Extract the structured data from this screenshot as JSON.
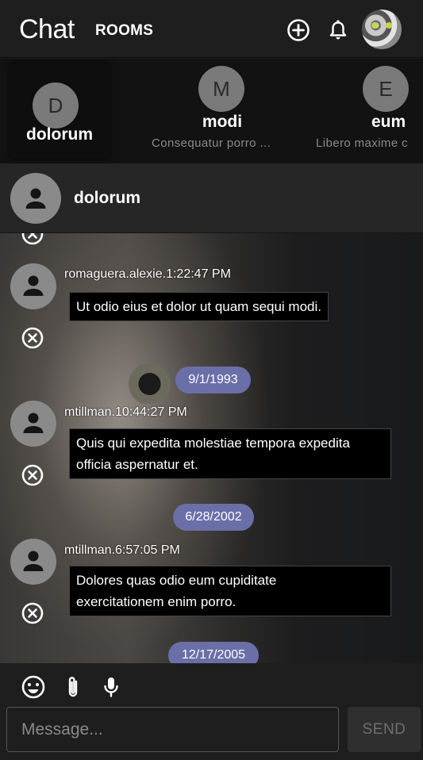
{
  "header": {
    "title": "Chat",
    "rooms_label": "ROOMS",
    "icons": {
      "add": "add-circle-icon",
      "notifications": "bell-icon",
      "avatar": "user-avatar-photo"
    }
  },
  "rooms": [
    {
      "initial": "D",
      "name": "dolorum",
      "preview": "",
      "active": true
    },
    {
      "initial": "M",
      "name": "modi",
      "preview": "Consequatur porro ...",
      "active": false
    },
    {
      "initial": "E",
      "name": "eum",
      "preview": "Libero maxime c",
      "active": false
    }
  ],
  "current_room": {
    "name": "dolorum"
  },
  "messages": [
    {
      "author": "romaguera.alexie.",
      "time": "1:22:47 PM",
      "text": "Ut odio eius et dolor ut quam sequi modi."
    },
    {
      "date": "9/1/1993"
    },
    {
      "author": "mtillman.",
      "time": "10:44:27 PM",
      "text_lines": [
        "Quis qui expedita molestiae tempora expedita",
        "officia aspernatur et."
      ]
    },
    {
      "date": "6/28/2002"
    },
    {
      "author": "mtillman.",
      "time": "6:57:05 PM",
      "text_lines": [
        "Dolores quas odio eum cupiditate",
        "exercitationem enim porro."
      ]
    },
    {
      "date": "12/17/2005"
    }
  ],
  "composer": {
    "placeholder": "Message...",
    "send_label": "SEND",
    "tools": [
      "emoji-icon",
      "attachment-icon",
      "microphone-icon"
    ]
  },
  "colors": {
    "background": "#1c1c1c",
    "date_chip": "#6b6fa8",
    "avatar_gray": "#8a8a8a"
  }
}
